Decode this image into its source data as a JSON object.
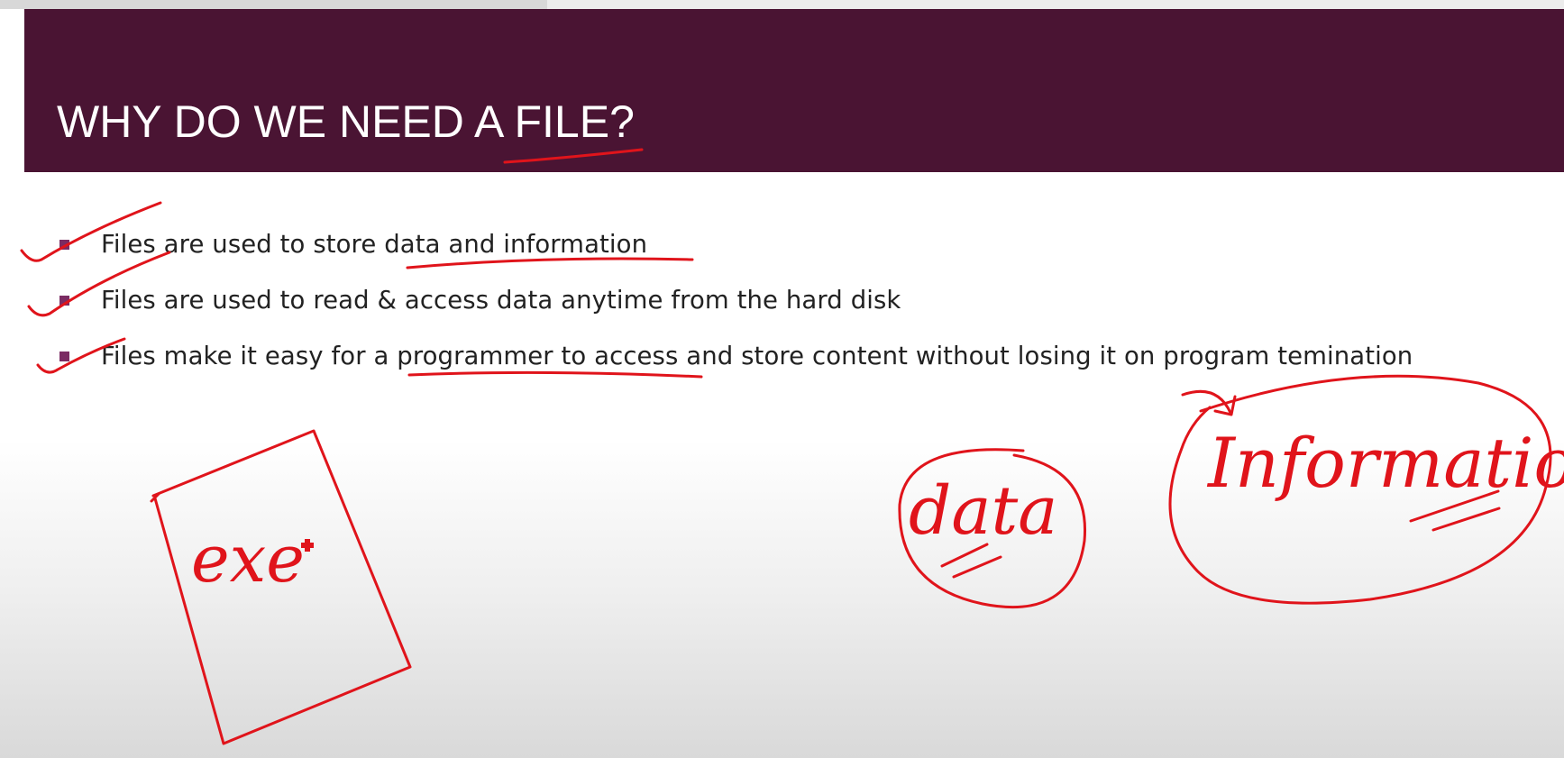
{
  "slide": {
    "title": "WHY DO WE NEED A FILE?",
    "bullets": [
      "Files are used to store data and information",
      "Files are used to read & access data anytime from the hard disk",
      "Files make it easy for a programmer to access and store content without losing it on program temination"
    ]
  },
  "annotations": {
    "file_label": "exe",
    "data_label": "data",
    "information_label": "Information"
  },
  "video": {
    "progress_fraction": 0.35
  },
  "colors": {
    "title_bar": "#4a1433",
    "bullet_marker": "#7b2c63",
    "ink": "#e0141b"
  }
}
